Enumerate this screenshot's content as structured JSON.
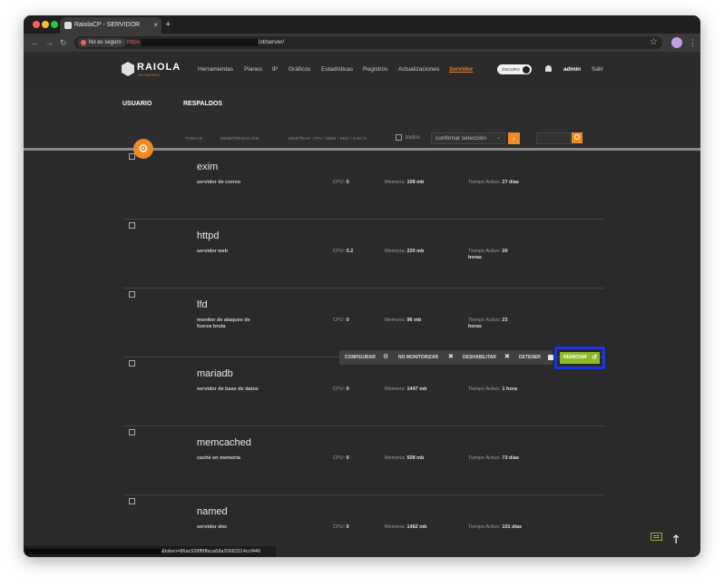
{
  "browser": {
    "tab_title": "RaiolaCP - SERVIDOR",
    "tab_close": "×",
    "new_tab": "+",
    "security_label": "No es seguro",
    "url_protocol": "https",
    "url_path": "ist/server/",
    "status_url": "&token=86ac928ff9ffaca68a20683314ccf440",
    "colors": {
      "close": "#ff5f57",
      "minimize": "#febc2e",
      "maximize": "#28c840"
    }
  },
  "header": {
    "logo": "RAIOLA",
    "logo_sub": "NETWORKS",
    "nav": [
      "Herramientas",
      "Planes",
      "IP",
      "Gráficos",
      "Estadísticas",
      "Registros",
      "Actualizaciones",
      "Servidor"
    ],
    "active_nav": "Servidor",
    "toggle_label": "OSCURO",
    "user": "admin",
    "logout": "Salir"
  },
  "subnav": {
    "items": [
      "USUARIO",
      "RESPALDOS"
    ]
  },
  "filters": {
    "tabs": [
      "TAREAS",
      "MONITORIZACIÓN",
      "MOSTRAR: CPU / MEM / RED / DISCO"
    ],
    "all_label": "todos",
    "select_value": "confirmar selección",
    "go": "›"
  },
  "services": [
    {
      "name": "exim",
      "desc": "servidor de correo",
      "cpu_label": "CPU:",
      "cpu": "0",
      "mem_label": "Memoria:",
      "mem": "108 mb",
      "uptime_label": "Tiempo Activo:",
      "uptime": "27 días"
    },
    {
      "name": "httpd",
      "desc": "servidor web",
      "cpu_label": "CPU:",
      "cpu": "0.2",
      "mem_label": "Memoria:",
      "mem": "220 mb",
      "uptime_label": "Tiempo Activo:",
      "uptime": "20 horas"
    },
    {
      "name": "lfd",
      "desc": "monitor de ataques de fuerza bruta",
      "cpu_label": "CPU:",
      "cpu": "0",
      "mem_label": "Memoria:",
      "mem": "96 mb",
      "uptime_label": "Tiempo Activo:",
      "uptime": "23 horas"
    },
    {
      "name": "mariadb",
      "desc": "servidor de base de datos",
      "cpu_label": "CPU:",
      "cpu": "0",
      "mem_label": "Memoria:",
      "mem": "1447 mb",
      "uptime_label": "Tiempo Activo:",
      "uptime": "1 hora"
    },
    {
      "name": "memcached",
      "desc": "caché en memoria",
      "cpu_label": "CPU:",
      "cpu": "0",
      "mem_label": "Memoria:",
      "mem": "508 mb",
      "uptime_label": "Tiempo Activo:",
      "uptime": "73 días"
    },
    {
      "name": "named",
      "desc": "servidor dns",
      "cpu_label": "CPU:",
      "cpu": "0",
      "mem_label": "Memoria:",
      "mem": "1482 mb",
      "uptime_label": "Tiempo Activo:",
      "uptime": "101 días"
    }
  ],
  "actions": {
    "configure": "CONFIGURAR",
    "unmonitor": "NO MONITORIZAR",
    "disable": "DESHABILITAR",
    "stop": "DETENER",
    "restart": "REINICIAR"
  },
  "icons": {
    "gear": "gear-icon",
    "close": "close-icon",
    "redo": "redo-icon",
    "scroll_top": "arrow-up-icon",
    "keyboard": "keyboard-icon"
  }
}
